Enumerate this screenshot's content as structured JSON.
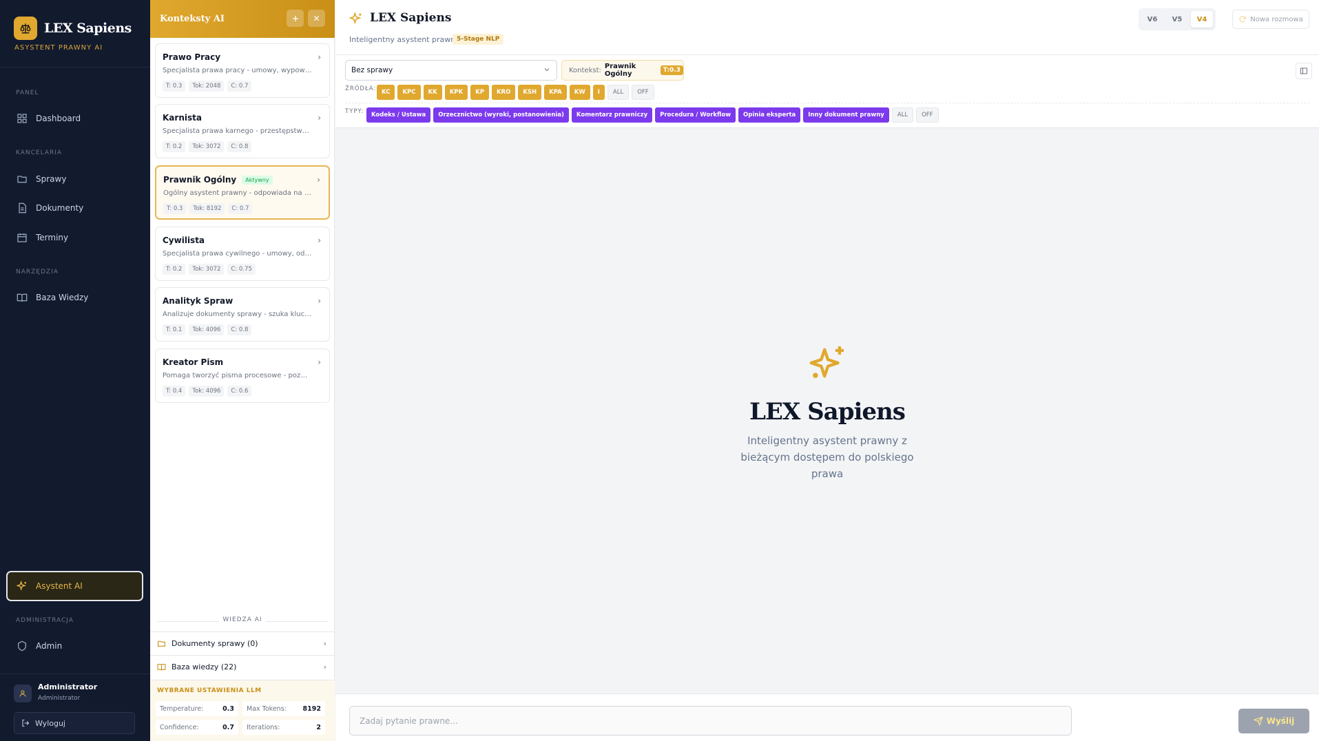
{
  "sidebar": {
    "brand": "LEX Sapiens",
    "tagline": "ASYSTENT PRAWNY AI",
    "sections": {
      "panel": "PANEL",
      "kancelaria": "KANCELARIA",
      "narzedzia": "NARZĘDZIA",
      "administracja": "ADMINISTRACJA"
    },
    "items": {
      "dashboard": "Dashboard",
      "sprawy": "Sprawy",
      "dokumenty": "Dokumenty",
      "terminy": "Terminy",
      "baza_wiedzy": "Baza Wiedzy",
      "asystent": "Asystent AI",
      "admin": "Admin"
    },
    "user": {
      "name": "Administrator",
      "role": "Administrator"
    },
    "logout": "Wyloguj"
  },
  "contexts": {
    "title": "Konteksty AI",
    "cards": [
      {
        "name": "Prawo Pracy",
        "desc": "Specjalista prawa pracy - umowy, wypowiedzenia, mobbing",
        "t": "T: 0.3",
        "tok": "Tok: 2048",
        "c": "C: 0.7"
      },
      {
        "name": "Karnista",
        "desc": "Specjalista prawa karnego - przestępstwa, kary, postępowanie",
        "t": "T: 0.2",
        "tok": "Tok: 3072",
        "c": "C: 0.8"
      },
      {
        "name": "Prawnik Ogólny",
        "badge": "Aktywny",
        "desc": "Ogólny asystent prawny - odpowiada na szeroki zakres pytań",
        "t": "T: 0.3",
        "tok": "Tok: 8192",
        "c": "C: 0.7"
      },
      {
        "name": "Cywilista",
        "desc": "Specjalista prawa cywilnego - umowy, odszkodowania, spadki",
        "t": "T: 0.2",
        "tok": "Tok: 3072",
        "c": "C: 0.75"
      },
      {
        "name": "Analityk Spraw",
        "desc": "Analizuje dokumenty sprawy - szuka kluczowych faktów",
        "t": "T: 0.1",
        "tok": "Tok: 4096",
        "c": "C: 0.8"
      },
      {
        "name": "Kreator Pism",
        "desc": "Pomaga tworzyć pisma procesowe - pozwy, wnioski",
        "t": "T: 0.4",
        "tok": "Tok: 4096",
        "c": "C: 0.6"
      }
    ],
    "wiedza_label": "WIEDZA AI",
    "docs": "Dokumenty sprawy (0)",
    "kb": "Baza wiedzy (22)",
    "llm": {
      "title": "WYBRANE USTAWIENIA LLM",
      "temperature_label": "Temperature:",
      "temperature": "0.3",
      "max_tokens_label": "Max Tokens:",
      "max_tokens": "8192",
      "confidence_label": "Confidence:",
      "confidence": "0.7",
      "iterations_label": "Iterations:",
      "iterations": "2"
    }
  },
  "main": {
    "title": "LEX Sapiens",
    "subtitle": "Inteligentny asystent prawny",
    "badge": "5-Stage NLP",
    "versions": [
      "V6",
      "V5",
      "V4"
    ],
    "active_version": "V4",
    "new_conversation": "Nowa rozmowa",
    "case_select": "Bez sprawy",
    "context_label": "Kontekst:",
    "context_value": "Prawnik Ogólny",
    "context_t": "T:0.3",
    "sources_label": "ŹRÓDŁA:",
    "sources": [
      "KC",
      "KPC",
      "KK",
      "KPK",
      "KP",
      "KRO",
      "KSH",
      "KPA",
      "KW",
      "I"
    ],
    "types_label": "TYPY:",
    "types": [
      "Kodeks / Ustawa",
      "Orzecznictwo (wyroki, postanowienia)",
      "Komentarz prawniczy",
      "Procedura / Workflow",
      "Opinia eksperta",
      "Inny dokument prawny"
    ],
    "all": "ALL",
    "off": "OFF",
    "hero_title": "LEX Sapiens",
    "hero_sub": "Inteligentny asystent prawny z bieżącym dostępem do polskiego prawa",
    "input_placeholder": "Zadaj pytanie prawne...",
    "send": "Wyślij"
  },
  "colors": {
    "accent": "#e0a82e",
    "sidebar_bg": "#121a2e",
    "type_chip": "#7c3aed"
  }
}
